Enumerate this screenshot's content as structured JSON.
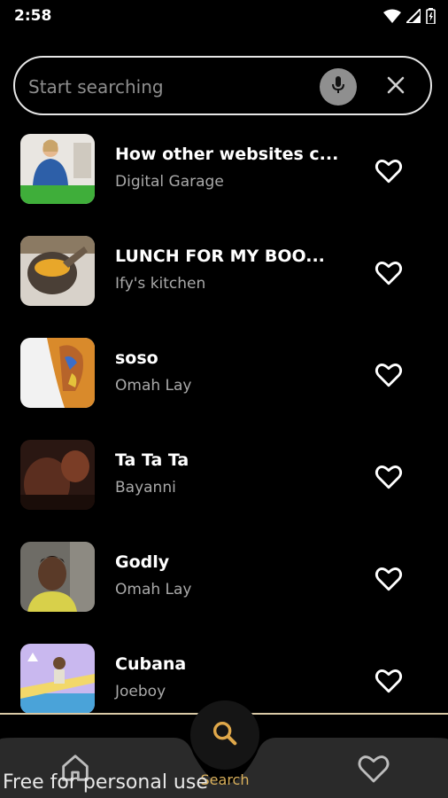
{
  "status_bar": {
    "time": "2:58",
    "icons": [
      "wifi-icon",
      "signal-icon",
      "battery-icon"
    ]
  },
  "search": {
    "placeholder": "Start searching",
    "value": "",
    "mic_icon": "mic-icon",
    "clear_icon": "close-icon"
  },
  "results": [
    {
      "title": "How other websites c...",
      "subtitle": "Digital Garage",
      "favorite": false
    },
    {
      "title": "LUNCH FOR MY BOO...",
      "subtitle": "Ify's kitchen",
      "favorite": false
    },
    {
      "title": "soso",
      "subtitle": "Omah Lay",
      "favorite": false
    },
    {
      "title": "Ta Ta Ta",
      "subtitle": "Bayanni",
      "favorite": false
    },
    {
      "title": "Godly",
      "subtitle": "Omah Lay",
      "favorite": false
    },
    {
      "title": "Cubana",
      "subtitle": "Joeboy",
      "favorite": false
    }
  ],
  "bottom_nav": {
    "home_icon": "home-icon",
    "search_icon": "search-icon",
    "search_label": "Search",
    "favorites_icon": "heart-icon",
    "active": "search"
  },
  "watermark": "Free for personal use",
  "colors": {
    "background": "#000000",
    "accent": "#d9b05c",
    "nav_bar": "#2a2a2a",
    "mic_button": "#8f8f8f"
  }
}
